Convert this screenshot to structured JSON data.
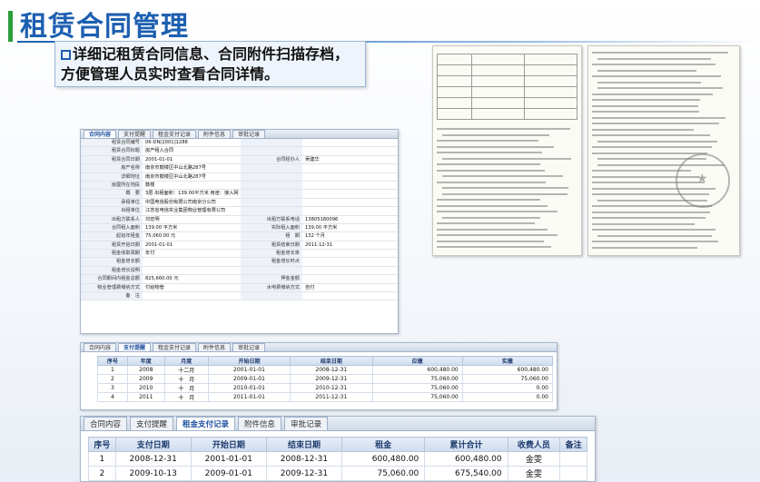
{
  "title": "租赁合同管理",
  "callout": {
    "line1": "详细记租赁合同信息、合同附件扫描存档，",
    "line2": "方便管理人员实时查看合同详情。"
  },
  "colors": {
    "title": "#1d5fb0",
    "accent": "#2a9d3a"
  },
  "contract_form": {
    "tabs": [
      "合同内容",
      "支付提醒",
      "租金支付记录",
      "附件信息",
      "审批记录"
    ],
    "active_tab": 0,
    "rows": [
      {
        "l": "租赁合同编号",
        "v": "06-DN[2001]1288",
        "l2": "",
        "v2": ""
      },
      {
        "l": "租赁合同标题",
        "v": "房产租入合同",
        "l2": "",
        "v2": ""
      },
      {
        "l": "租赁合同日期",
        "v": "2001-01-01",
        "l2": "合同经办人",
        "v2": "吴建华"
      },
      {
        "l": "房产名称",
        "v": "南京市鼓楼区中山北路287号",
        "l2": "",
        "v2": ""
      },
      {
        "l": "详细地址",
        "v": "南京市鼓楼区中山北路287号",
        "l2": "",
        "v2": ""
      },
      {
        "l": "房屋所在地段",
        "v": "鼓楼",
        "l2": "",
        "v2": ""
      },
      {
        "l": "概　要",
        "v": "3层 出租面积：139.00平方米 用途：接入网",
        "l2": "",
        "v2": ""
      },
      {
        "l": "承租单位",
        "v": "中国电信股份有限公司南京分公司",
        "l2": "",
        "v2": ""
      },
      {
        "l": "出租单位",
        "v": "江苏省电信实业集团物业管理有限公司",
        "l2": "",
        "v2": ""
      },
      {
        "l": "出租方联系人",
        "v": "刘宏明",
        "l2": "出租方联系电话",
        "v2": "13805180096"
      },
      {
        "l": "合同租入面积",
        "v": "139.00 平方米",
        "l2": "实际租入面积",
        "v2": "139.00 平方米"
      },
      {
        "l": "起始年租金",
        "v": "75,060.00 元",
        "l2": "租　期",
        "v2": "132 个月"
      },
      {
        "l": "租赁开始日期",
        "v": "2001-01-01",
        "l2": "租赁结束日期",
        "v2": "2011-12-31"
      },
      {
        "l": "租金收取周期",
        "v": "年付",
        "l2": "租金增长率",
        "v2": ""
      },
      {
        "l": "租金增长额",
        "v": "",
        "l2": "租金增长时点",
        "v2": ""
      },
      {
        "l": "租金增长说明",
        "v": "",
        "l2": "",
        "v2": ""
      },
      {
        "l": "合同期间内租金总额",
        "v": "825,660.00 元",
        "l2": "押金金额",
        "v2": ""
      },
      {
        "l": "物业管理费缴纳方式",
        "v": "付给物管",
        "l2": "水电费缴纳方式",
        "v2": "自付"
      },
      {
        "l": "备　注",
        "v": "",
        "l2": "",
        "v2": ""
      }
    ]
  },
  "payment_reminder": {
    "tabs": [
      "合同内容",
      "支付提醒",
      "租金支付记录",
      "附件信息",
      "审批记录"
    ],
    "active_tab": 1,
    "headers": [
      "序号",
      "年度",
      "月度",
      "开始日期",
      "结束日期",
      "应缴",
      "实缴"
    ],
    "rows": [
      [
        "1",
        "2008",
        "十二月",
        "2001-01-01",
        "2008-12-31",
        "600,480.00",
        "600,480.00"
      ],
      [
        "2",
        "2009",
        "十　月",
        "2009-01-01",
        "2009-12-31",
        "75,060.00",
        "75,060.00"
      ],
      [
        "3",
        "2010",
        "十　月",
        "2010-01-01",
        "2010-12-31",
        "75,060.00",
        "0.00"
      ],
      [
        "4",
        "2011",
        "十　月",
        "2011-01-01",
        "2011-12-31",
        "75,060.00",
        "0.00"
      ]
    ]
  },
  "rent_records": {
    "tabs": [
      "合同内容",
      "支付提醒",
      "租金支付记录",
      "附件信息",
      "审批记录"
    ],
    "active_tab": 2,
    "headers": [
      "序号",
      "支付日期",
      "开始日期",
      "结束日期",
      "租金",
      "累计合计",
      "收费人员",
      "备注"
    ],
    "rows": [
      [
        "1",
        "2008-12-31",
        "2001-01-01",
        "2008-12-31",
        "600,480.00",
        "600,480.00",
        "金雯",
        ""
      ],
      [
        "2",
        "2009-10-13",
        "2009-01-01",
        "2009-12-31",
        "75,060.00",
        "675,540.00",
        "金雯",
        ""
      ]
    ]
  }
}
